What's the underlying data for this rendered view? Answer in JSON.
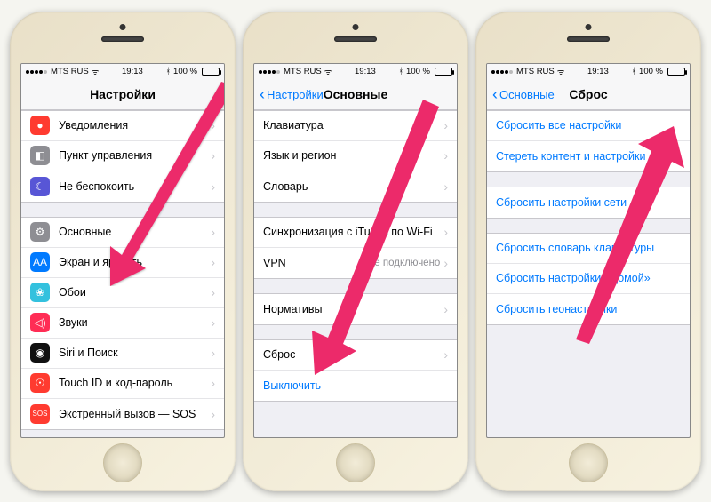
{
  "status": {
    "carrier": "MTS RUS",
    "time": "19:13",
    "battery_pct": "100 %"
  },
  "phone1": {
    "title": "Настройки",
    "group1": [
      {
        "icon": "●",
        "color": "#ff3b30",
        "label": "Уведомления"
      },
      {
        "icon": "◧",
        "color": "#8e8e93",
        "label": "Пункт управления"
      },
      {
        "icon": "☾",
        "color": "#5856d6",
        "label": "Не беспокоить"
      }
    ],
    "group2": [
      {
        "icon": "⚙",
        "color": "#8e8e93",
        "label": "Основные"
      },
      {
        "icon": "AA",
        "color": "#007aff",
        "label": "Экран и яркость"
      },
      {
        "icon": "❀",
        "color": "#33c1de",
        "label": "Обои"
      },
      {
        "icon": "◁)",
        "color": "#ff2d55",
        "label": "Звуки"
      },
      {
        "icon": "◉",
        "color": "#111",
        "label": "Siri и Поиск"
      },
      {
        "icon": "☉",
        "color": "#ff3b30",
        "label": "Touch ID и код-пароль"
      },
      {
        "icon": "SOS",
        "color": "#ff3b30",
        "label": "Экстренный вызов — SOS"
      }
    ]
  },
  "phone2": {
    "back": "Настройки",
    "title": "Основные",
    "group1": [
      {
        "label": "Клавиатура"
      },
      {
        "label": "Язык и регион"
      },
      {
        "label": "Словарь"
      }
    ],
    "group2": [
      {
        "label": "Синхронизация с iTunes по Wi-Fi"
      },
      {
        "label": "VPN",
        "value": "Не подключено"
      }
    ],
    "group3": [
      {
        "label": "Нормативы"
      }
    ],
    "group4": [
      {
        "label": "Сброс"
      },
      {
        "label": "Выключить",
        "link": true
      }
    ]
  },
  "phone3": {
    "back": "Основные",
    "title": "Сброс",
    "group1": [
      {
        "label": "Сбросить все настройки"
      },
      {
        "label": "Стереть контент и настройки"
      }
    ],
    "group2": [
      {
        "label": "Сбросить настройки сети"
      }
    ],
    "group3": [
      {
        "label": "Сбросить словарь клавиатуры"
      },
      {
        "label": "Сбросить настройки «Домой»"
      },
      {
        "label": "Сбросить геонастройки"
      }
    ]
  }
}
